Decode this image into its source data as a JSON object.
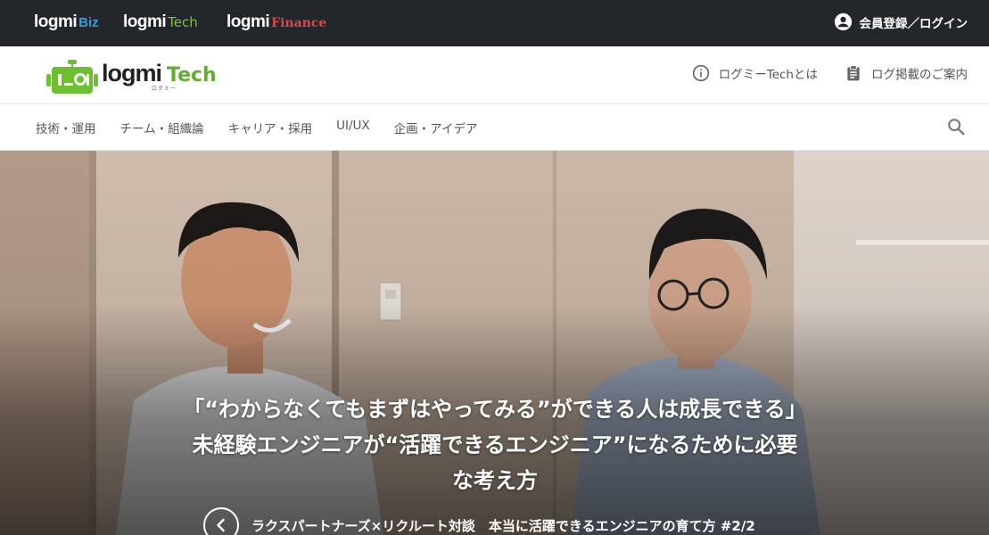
{
  "topbar": {
    "brands": [
      {
        "name": "logmi",
        "sub": "Biz"
      },
      {
        "name": "logmi",
        "sub": "Tech"
      },
      {
        "name": "logmi",
        "sub": "Finance"
      }
    ],
    "login_label": "会員登録／ログイン"
  },
  "header": {
    "logo": {
      "logmi": "logmi",
      "tech": "Tech",
      "kana": "ログミー"
    },
    "links": [
      {
        "label": "ログミーTechとは",
        "icon": "info-icon"
      },
      {
        "label": "ログ掲載のご案内",
        "icon": "clipboard-icon"
      }
    ]
  },
  "nav": {
    "categories": [
      "技術・運用",
      "チーム・組織論",
      "キャリア・採用",
      "UI/UX",
      "企画・アイデア"
    ]
  },
  "hero": {
    "title_line1": "「“わからなくてもまずはやってみる”ができる人は成長できる」",
    "title_line2": "未経験エンジニアが“活躍できるエンジニア”になるために必要",
    "title_line3": "な考え方",
    "series": "ラクスパートナーズ×リクルート対談　本当に活躍できるエンジニアの育て方 #2/2"
  },
  "colors": {
    "topbar_bg": "#23272b",
    "biz": "#3b9be0",
    "tech": "#7cc242",
    "finance": "#e04646",
    "logo_green": "#5fae2e"
  }
}
